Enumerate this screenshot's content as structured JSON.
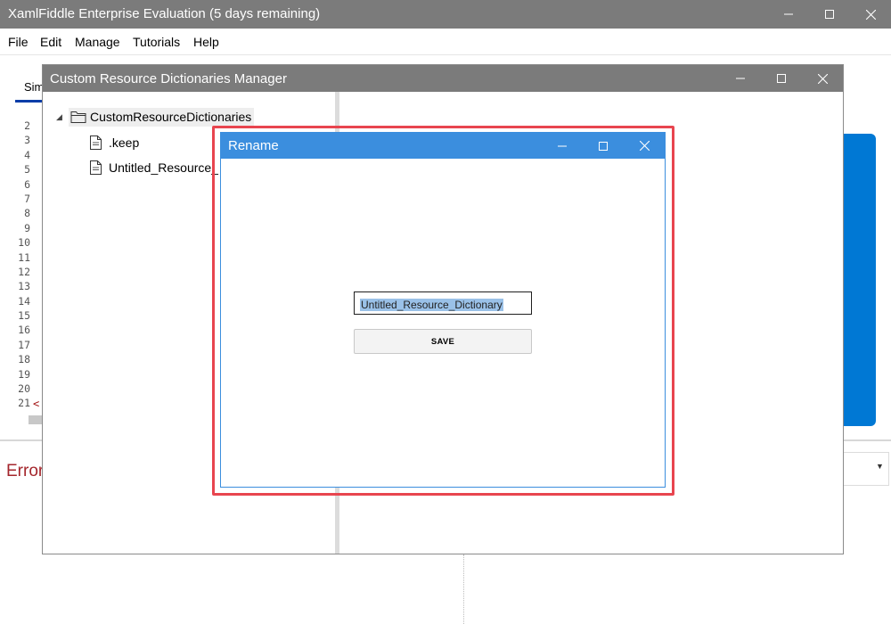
{
  "main_window": {
    "title": "XamlFiddle Enterprise Evaluation (5 days remaining)",
    "menu": [
      "File",
      "Edit",
      "Manage",
      "Tutorials",
      "Help"
    ],
    "tab_label": "Sim",
    "line_numbers": [
      "2",
      "3",
      "4",
      "5",
      "6",
      "7",
      "8",
      "9",
      "10",
      "11",
      "12",
      "13",
      "14",
      "15",
      "16",
      "17",
      "18",
      "19",
      "20",
      "21"
    ],
    "code_fragment": "<",
    "errors_label": "Error"
  },
  "manager_window": {
    "title": "Custom Resource Dictionaries Manager",
    "tree": {
      "root": "CustomResourceDictionaries",
      "children": [
        ".keep",
        "Untitled_Resource_"
      ]
    }
  },
  "rename_dialog": {
    "title": "Rename",
    "input_value": "Untitled_Resource_Dictionary",
    "save_label": "SAVE"
  },
  "colors": {
    "titlebar_gray": "#7b7b7b",
    "dialog_accent": "#3b8ede",
    "highlight_red": "#e8454f",
    "selection": "#9ac1e8"
  },
  "icons": [
    "minimize-icon",
    "maximize-icon",
    "close-icon",
    "expand-arrow-icon",
    "folder-icon",
    "file-icon",
    "dropdown-arrow-icon"
  ]
}
